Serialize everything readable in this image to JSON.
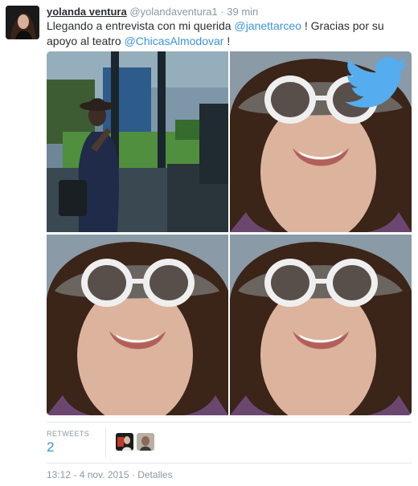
{
  "tweet": {
    "fullname": "yolanda ventura",
    "username": "@yolandaventura1",
    "separator": "·",
    "time": "39 min",
    "text_parts": {
      "p1": "Llegando a entrevista con mi querida ",
      "m1": "@janettarceo",
      "p2": " ! Gracias por su apoyo al teatro ",
      "m2": "@ChicasAlmodovar",
      "p3": " !"
    }
  },
  "media": {
    "photos": [
      {
        "description": "selfie-reflection"
      },
      {
        "description": "selfie-sunglasses"
      },
      {
        "description": "selfie-sunglasses"
      },
      {
        "description": "selfie-sunglasses"
      }
    ],
    "overlay_icon": "twitter-bird-icon",
    "colors": {
      "twitter_blue": "#55acee"
    }
  },
  "stats": {
    "retweets_label": "RETWEETS",
    "retweets_count": "2",
    "retweeter_icons": [
      "retweeter-avatar-icon",
      "retweeter-avatar-icon"
    ]
  },
  "footer": {
    "timestamp": "13:12 - 4 nov. 2015",
    "separator": "·",
    "details": "Detalles"
  },
  "colors": {
    "link": "#3b94d9",
    "muted": "#8899a6",
    "text": "#292f33",
    "border": "#e1e8ed"
  }
}
